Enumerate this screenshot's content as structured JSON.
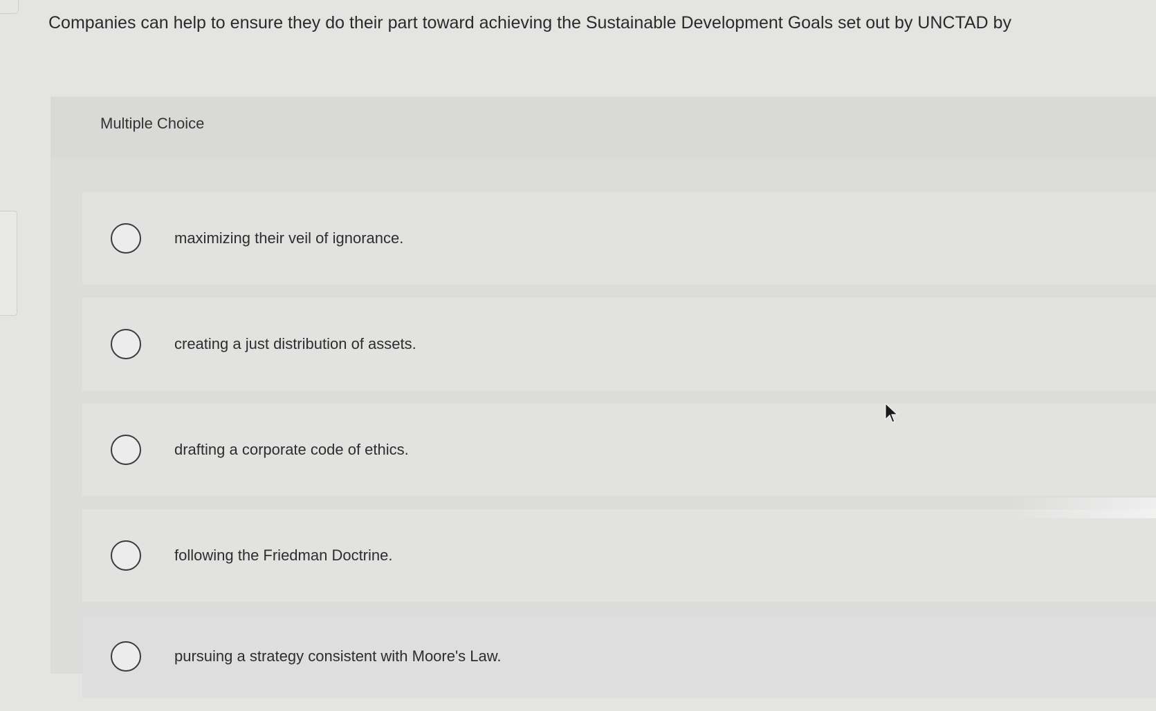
{
  "question": {
    "text": "Companies can help to ensure they do their part toward achieving the Sustainable Development Goals set out by UNCTAD by"
  },
  "multiple_choice": {
    "label": "Multiple Choice",
    "options": [
      {
        "text": "maximizing their veil of ignorance.",
        "selected": false
      },
      {
        "text": "creating a just distribution of assets.",
        "selected": false
      },
      {
        "text": "drafting a corporate code of ethics.",
        "selected": false
      },
      {
        "text": "following the Friedman Doctrine.",
        "selected": false
      },
      {
        "text": "pursuing a strategy consistent with Moore's Law.",
        "selected": false
      }
    ]
  },
  "icons": {
    "radio": "radio-unselected-icon",
    "cursor": "mouse-pointer-icon"
  },
  "colors": {
    "background": "#e4e4e3",
    "panel": "#dcdcdb",
    "text": "#2b2b2b"
  }
}
